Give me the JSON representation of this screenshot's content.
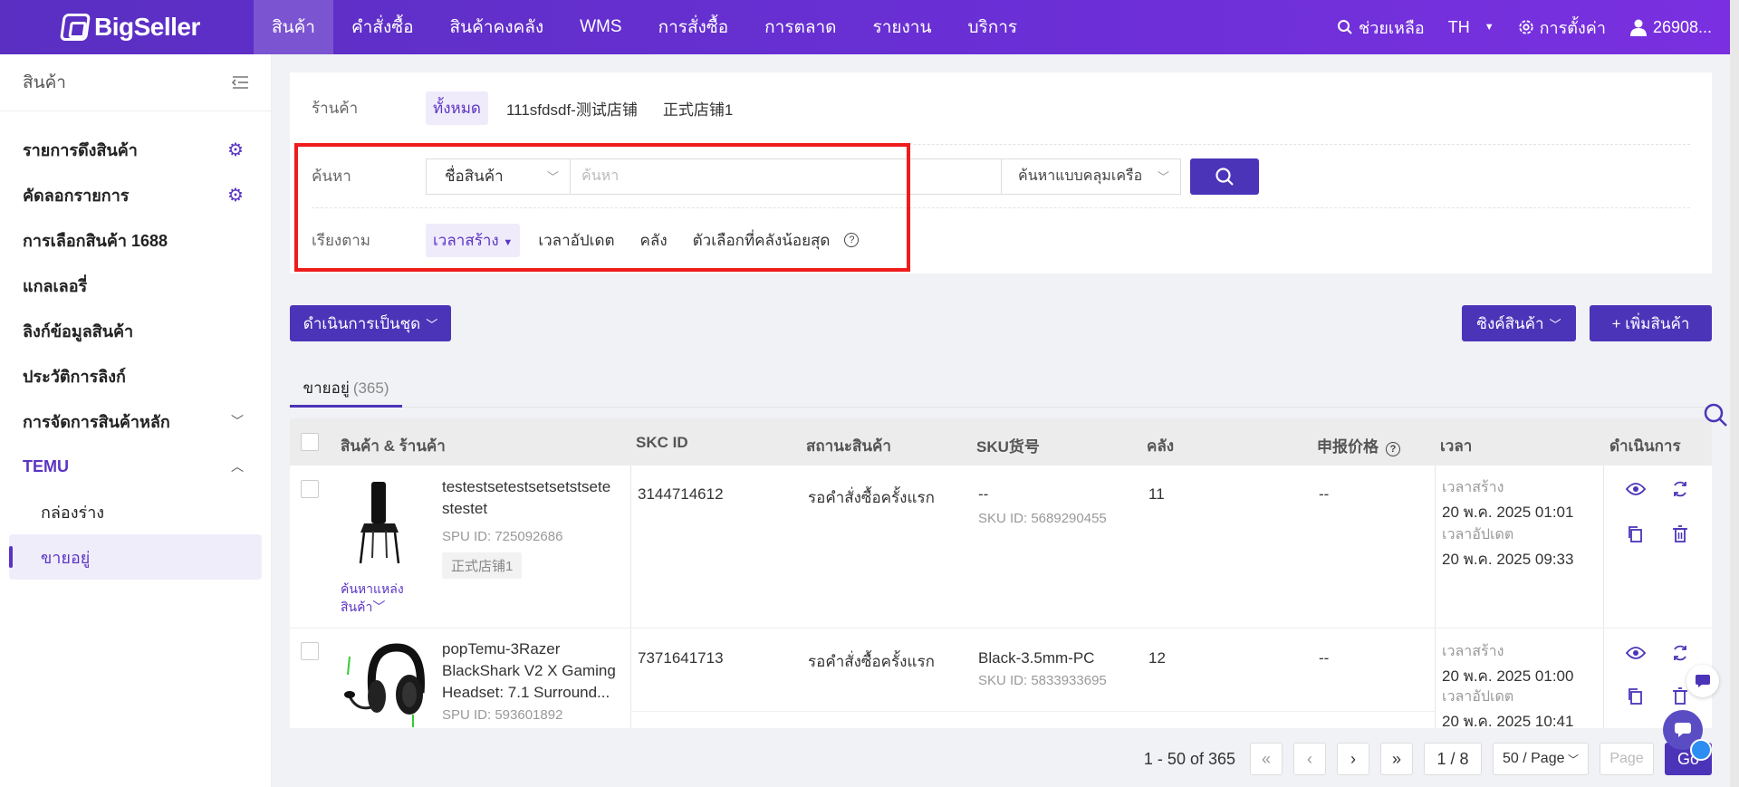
{
  "brand": "BigSeller",
  "nav": [
    "สินค้า",
    "คำสั่งซื้อ",
    "สินค้าคงคลัง",
    "WMS",
    "การสั่งซื้อ",
    "การตลาด",
    "รายงาน",
    "บริการ"
  ],
  "topright": {
    "help": "ช่วยเหลือ",
    "lang": "TH",
    "settings": "การตั้งค่า",
    "user": "26908..."
  },
  "sidebar": {
    "title": "สินค้า",
    "items": [
      "รายการดึงสินค้า",
      "คัดลอกรายการ",
      "การเลือกสินค้า 1688",
      "แกลเลอรี่",
      "ลิงก์ข้อมูลสินค้า",
      "ประวัติการลิงก์",
      "การจัดการสินค้าหลัก",
      "TEMU"
    ],
    "subs": [
      "กล่องร่าง",
      "ขายอยู่"
    ]
  },
  "filter": {
    "shop_label": "ร้านค้า",
    "shops": [
      "ทั้งหมด",
      "111sfdsdf-测试店铺",
      "正式店铺1"
    ],
    "search_label": "ค้นหา",
    "search_field": "ชื่อสินค้า",
    "search_placeholder": "ค้นหา",
    "search_mode": "ค้นหาแบบคลุมเครือ",
    "sort_label": "เรียงตาม",
    "sorts": [
      "เวลาสร้าง",
      "เวลาอัปเดต",
      "คลัง",
      "ตัวเลือกที่คลังน้อยสุด"
    ]
  },
  "actions": {
    "batch": "ดำเนินการเป็นชุด",
    "sync": "ซิงค์สินค้า",
    "add": "+ เพิ่มสินค้า"
  },
  "tab": {
    "label": "ขายอยู่",
    "count": "(365)"
  },
  "columns": [
    "สินค้า & ร้านค้า",
    "SKC ID",
    "สถานะสินค้า",
    "SKU货号",
    "คลัง",
    "申报价格",
    "เวลา",
    "ดำเนินการ"
  ],
  "rows": [
    {
      "name": "testestsetestsetsetstsete stestet",
      "spu": "SPU ID: 725092686",
      "shop": "正式店铺1",
      "source": "ค้นหาแหล่งสินค้า",
      "skc": "3144714612",
      "status": "รอคำสั่งซื้อครั้งแรก",
      "sku": "--",
      "sku_id": "SKU ID: 5689290455",
      "stock": "11",
      "price": "--",
      "created_label": "เวลาสร้าง",
      "created": "20 พ.ค. 2025 01:01",
      "updated_label": "เวลาอัปเดต",
      "updated": "20 พ.ค. 2025 09:33"
    },
    {
      "name": "popTemu-3Razer BlackShark V2 X Gaming Headset: 7.1 Surround...",
      "spu": "SPU ID: 593601892",
      "skc": "7371641713",
      "status": "รอคำสั่งซื้อครั้งแรก",
      "sku": "Black-3.5mm-PC",
      "sku_id": "SKU ID: 5833933695",
      "stock": "12",
      "price": "--",
      "created_label": "เวลาสร้าง",
      "created": "20 พ.ค. 2025 01:00",
      "updated_label": "เวลาอัปเดต",
      "updated": "20 พ.ค. 2025 10:41"
    }
  ],
  "pager": {
    "range": "1 - 50 of 365",
    "page": "1 / 8",
    "size": "50 / Page",
    "page_placeholder": "Page",
    "go": "Go"
  }
}
